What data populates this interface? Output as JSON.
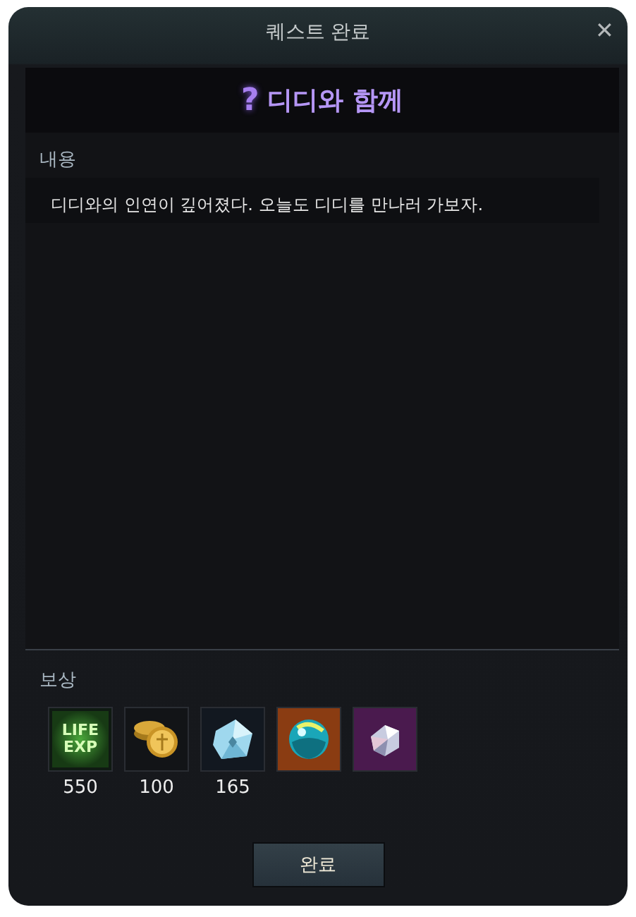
{
  "window": {
    "title": "퀘스트 완료",
    "close": "✕"
  },
  "quest": {
    "mark": "?",
    "title": "디디와 함께"
  },
  "content": {
    "label": "내용",
    "text": "디디와의 인연이 깊어졌다. 오늘도 디디를 만나러 가보자."
  },
  "rewards": {
    "label": "보상",
    "items": [
      {
        "kind": "life-exp",
        "color": "#0f1a12",
        "icon_text": [
          "LIFE",
          "EXP"
        ],
        "count": "550"
      },
      {
        "kind": "coin",
        "color": "#121417",
        "count": "100"
      },
      {
        "kind": "crystal",
        "color": "#121820",
        "count": "165"
      },
      {
        "kind": "orb",
        "color": "#8a3c12"
      },
      {
        "kind": "gem",
        "color": "#4a1a4e"
      }
    ]
  },
  "buttons": [
    {
      "label": "완료"
    }
  ]
}
